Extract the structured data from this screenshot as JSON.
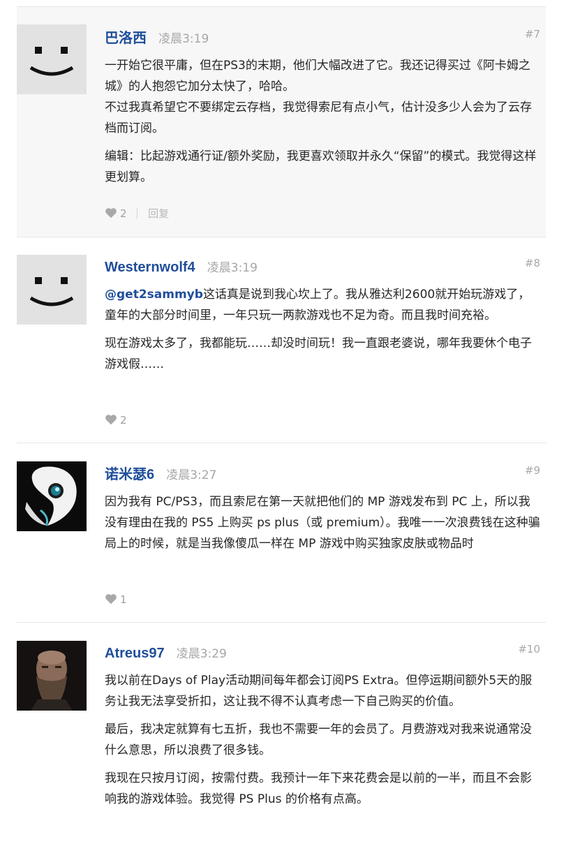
{
  "comments": [
    {
      "author": "巴洛西",
      "time": "凌晨3:19",
      "number": "#7",
      "avatar": "smiley-avatar",
      "paragraphs": [
        "一开始它很平庸，但在PS3的末期，他们大幅改进了它。我还记得买过《阿卡姆之城》的人抱怨它加分太快了，哈哈。\n不过我真希望它不要绑定云存档，我觉得索尼有点小气，估计没多少人会为了云存档而订阅。",
        "编辑：比起游戏通行证/额外奖励，我更喜欢领取并永久“保留”的模式。我觉得这样更划算。"
      ],
      "likes": "2",
      "reply_label": "回复"
    },
    {
      "author": "Westernwolf4",
      "time": "凌晨3:19",
      "number": "#8",
      "avatar": "smiley-avatar",
      "mention": "@get2sammyb",
      "first_paragraph_rest": "这话真是说到我心坎上了。我从雅达利2600就开始玩游戏了，童年的大部分时间里，一年只玩一两款游戏也不足为奇。而且我时间充裕。",
      "paragraphs": [
        "现在游戏太多了，我都能玩……却没时间玩！我一直跟老婆说，哪年我要休个电子游戏假……"
      ],
      "likes": "2"
    },
    {
      "author": "诺米瑟6",
      "time": "凌晨3:27",
      "number": "#9",
      "avatar": "white-creature-avatar",
      "paragraphs": [
        "因为我有 PC/PS3，而且索尼在第一天就把他们的 MP 游戏发布到 PC 上，所以我没有理由在我的 PS5 上购买 ps plus（或 premium）。我唯一一次浪费钱在这种骗局上的时候，就是当我像傻瓜一样在 MP 游戏中购买独家皮肤或物品时"
      ],
      "likes": "1"
    },
    {
      "author": "Atreus97",
      "time": "凌晨3:29",
      "number": "#10",
      "avatar": "bearded-man-avatar",
      "paragraphs": [
        "我以前在Days of Play活动期间每年都会订阅PS Extra。但停运期间额外5天的服务让我无法享受折扣，这让我不得不认真考虑一下自己购买的价值。",
        "最后，我决定就算有七五折，我也不需要一年的会员了。月费游戏对我来说通常没什么意思，所以浪费了很多钱。",
        "我现在只按月订阅，按需付费。我预计一年下来花费会是以前的一半，而且不会影响我的游戏体验。我觉得 PS Plus 的价格有点高。"
      ]
    }
  ],
  "colors": {
    "author": "#1f4e9a",
    "muted": "#a6a6a6",
    "highlight_bg": "#f7f7f7"
  }
}
